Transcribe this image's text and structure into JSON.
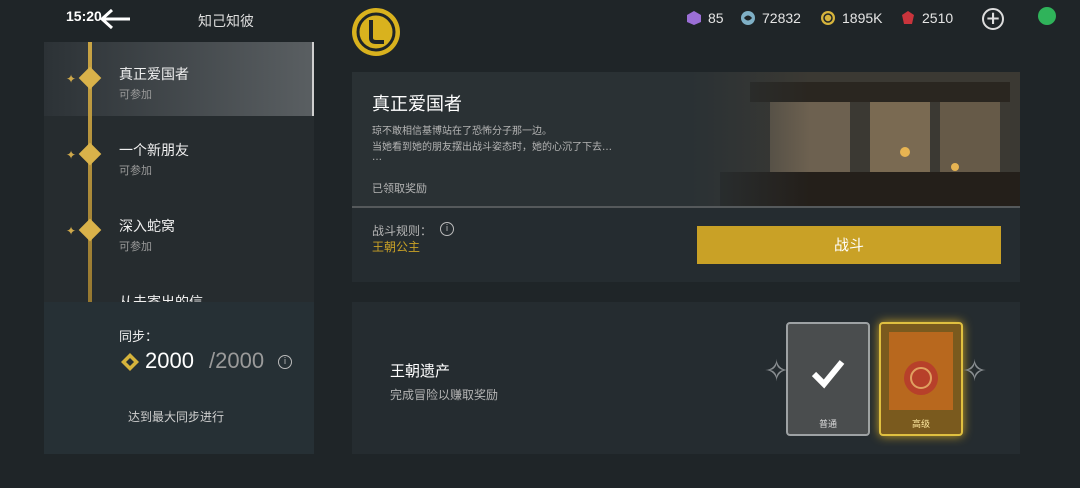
{
  "status": {
    "time": "15:20"
  },
  "header": {
    "title": "知己知彼"
  },
  "resources": [
    {
      "icon": "purple-cube-icon",
      "value": "85",
      "color": "#9b6fd6"
    },
    {
      "icon": "swirl-icon",
      "value": "72832",
      "color": "#7fb0c6"
    },
    {
      "icon": "gold-coin-icon",
      "value": "1895K",
      "color": "#d6b43c"
    },
    {
      "icon": "red-gem-icon",
      "value": "2510",
      "color": "#c9343c"
    }
  ],
  "chapters": [
    {
      "name": "真正爱国者",
      "status": "可参加"
    },
    {
      "name": "一个新朋友",
      "status": "可参加"
    },
    {
      "name": "深入蛇窝",
      "status": "可参加"
    },
    {
      "name": "从未寄出的信",
      "status": ""
    }
  ],
  "sync": {
    "label": "同步：",
    "current": "2000",
    "max": "/2000",
    "note": "达到最大同步进行"
  },
  "mission": {
    "title": "真正爱国者",
    "desc_line1": "琼不敢相信基博站在了恐怖分子那一边。",
    "desc_line2": "当她看到她的朋友摆出战斗姿态时，她的心沉了下去…",
    "desc_more": "…",
    "reward_status": "已领取奖励",
    "rule_label": "战斗规则：",
    "rule_value": "王朝公主",
    "fight_label": "战斗"
  },
  "legacy": {
    "title": "王朝遗产",
    "desc": "完成冒险以赚取奖励",
    "card1_label": "普通",
    "card2_label": "高级"
  },
  "colors": {
    "gold": "#c9a126",
    "accent_line": "#d9b24a"
  }
}
